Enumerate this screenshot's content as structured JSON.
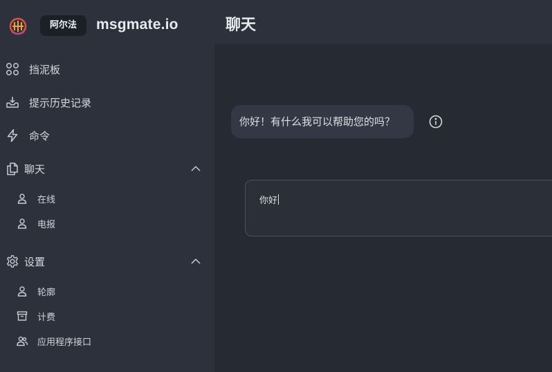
{
  "brand": {
    "badge": "阿尔法",
    "app_name": "msgmate.io"
  },
  "header": {
    "title": "聊天"
  },
  "sidebar": {
    "items": [
      {
        "label": "挡泥板",
        "icon": "dashboard-icon"
      },
      {
        "label": "提示历史记录",
        "icon": "inbox-icon"
      },
      {
        "label": "命令",
        "icon": "lightning-icon"
      }
    ],
    "chat_group": {
      "label": "聊天",
      "icon": "documents-icon",
      "expanded": true,
      "items": [
        {
          "label": "在线",
          "icon": "user-icon"
        },
        {
          "label": "电报",
          "icon": "user-icon"
        }
      ]
    },
    "settings_group": {
      "label": "设置",
      "icon": "gear-icon",
      "expanded": true,
      "items": [
        {
          "label": "轮廓",
          "icon": "user-icon"
        },
        {
          "label": "计费",
          "icon": "archive-icon"
        },
        {
          "label": "应用程序接口",
          "icon": "users-icon"
        }
      ]
    }
  },
  "chat": {
    "messages": [
      {
        "text": "你好！有什么我可以帮助您的吗？",
        "role": "assistant"
      }
    ],
    "input": {
      "value": "你好"
    }
  },
  "colors": {
    "sidebar_bg": "#2c313b",
    "main_bg": "#262a33",
    "bubble_bg": "#323844"
  }
}
